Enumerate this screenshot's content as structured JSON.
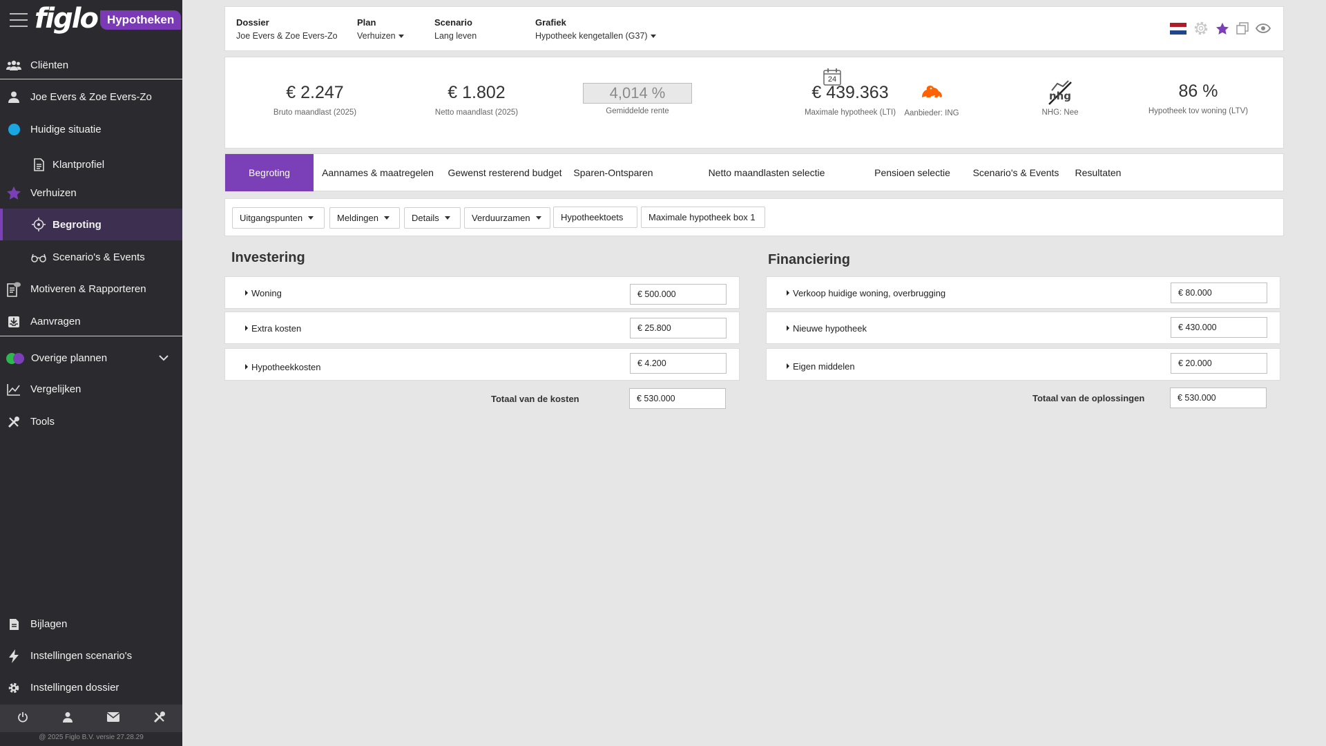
{
  "sidebar": {
    "logo_text": "figlo",
    "logo_badge": "Hypotheken",
    "items": {
      "clienten": "Cliënten",
      "client": "Joe Evers & Zoe Evers-Zo",
      "huidige": "Huidige situatie",
      "klantprofiel": "Klantprofiel",
      "verhuizen": "Verhuizen",
      "begroting": "Begroting",
      "scenarios": "Scenario's & Events",
      "motiveren": "Motiveren & Rapporteren",
      "aanvragen": "Aanvragen",
      "overige": "Overige plannen",
      "vergelijken": "Vergelijken",
      "tools": "Tools",
      "bijlagen": "Bijlagen",
      "inst_scenario": "Instellingen scenario's",
      "inst_dossier": "Instellingen dossier"
    },
    "copyright": "@ 2025 Figlo B.V. versie 27.28.29"
  },
  "header": {
    "dossier_label": "Dossier",
    "dossier_value": "Joe Evers & Zoe Evers-Zo",
    "plan_label": "Plan",
    "plan_value": "Verhuizen",
    "scenario_label": "Scenario",
    "scenario_value": "Lang leven",
    "grafiek_label": "Grafiek",
    "grafiek_value": "Hypotheek kengetallen (G37)"
  },
  "kpis": {
    "bruto_value": "€ 2.247",
    "bruto_label": "Bruto maandlast (2025)",
    "netto_value": "€ 1.802",
    "netto_label": "Netto maandlast (2025)",
    "rente_value": "4,014 %",
    "rente_label": "Gemiddelde rente",
    "max_value": "€ 439.363",
    "max_label": "Maximale hypotheek (LTI)",
    "calendar_day": "24",
    "aanbieder_label": "Aanbieder: ING",
    "nhg_logo": "nhg",
    "nhg_label": "NHG: Nee",
    "ltv_value": "86 %",
    "ltv_label": "Hypotheek tov woning (LTV)"
  },
  "tabs": [
    "Begroting",
    "Aannames & maatregelen",
    "Gewenst resterend budget",
    "Sparen-Ontsparen",
    "Netto maandlasten selectie",
    "Pensioen selectie",
    "Scenario's & Events",
    "Resultaten"
  ],
  "toolbar": {
    "uitgangspunten": "Uitgangspunten",
    "meldingen": "Meldingen",
    "details": "Details",
    "verduurzamen": "Verduurzamen",
    "hypotheektoets": "Hypotheektoets",
    "max_box1": "Maximale hypotheek box 1"
  },
  "investering": {
    "title": "Investering",
    "rows": [
      {
        "label": "Woning",
        "value": "€ 500.000"
      },
      {
        "label": "Extra kosten",
        "value": "€ 25.800"
      },
      {
        "label": "Hypotheekkosten",
        "value": "€ 4.200"
      }
    ],
    "total_label": "Totaal van de kosten",
    "total_value": "€ 530.000"
  },
  "financiering": {
    "title": "Financiering",
    "rows": [
      {
        "label": "Verkoop huidige woning, overbrugging",
        "value": "€ 80.000"
      },
      {
        "label": "Nieuwe hypotheek",
        "value": "€ 430.000"
      },
      {
        "label": "Eigen middelen",
        "value": "€ 20.000"
      }
    ],
    "total_label": "Totaal van de oplossingen",
    "total_value": "€ 530.000"
  },
  "colors": {
    "accent": "#7b3fb8",
    "sidebar_bg": "#2b2b2f",
    "huidige_dot": "#1aa6e0"
  }
}
